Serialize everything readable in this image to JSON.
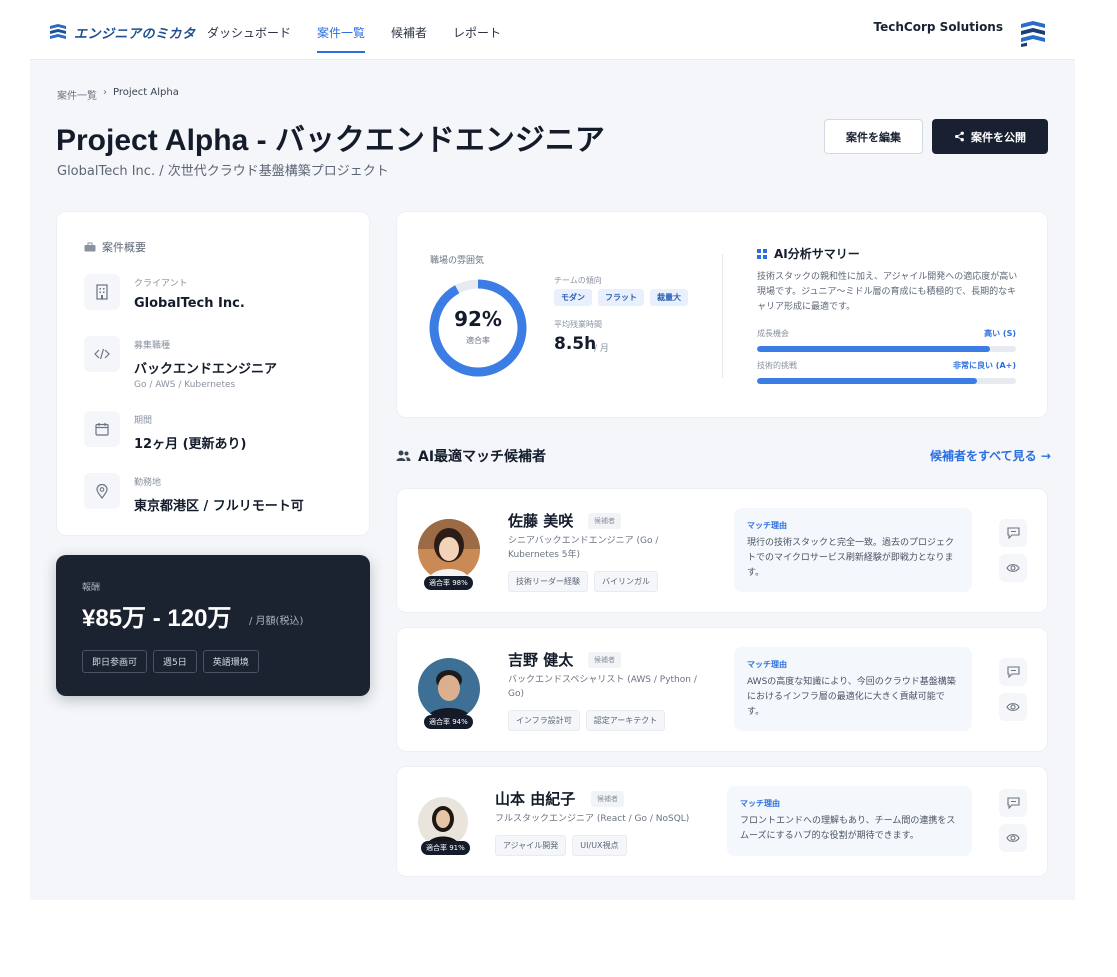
{
  "header": {
    "logo_text": "エンジニアのミカタ",
    "nav": [
      "ダッシュボード",
      "案件一覧",
      "候補者",
      "レポート"
    ],
    "active_nav": "案件一覧",
    "company": "TechCorp Solutions"
  },
  "breadcrumb": {
    "parent": "案件一覧",
    "separator": "›",
    "current": "Project Alpha"
  },
  "page": {
    "title": "Project Alpha - バックエンドエンジニア",
    "subtitle": "GlobalTech Inc. / 次世代クラウド基盤構築プロジェクト",
    "edit_button": "案件を編集",
    "publish_button": "案件を公開"
  },
  "overview": {
    "title": "案件概要",
    "client_label": "クライアント",
    "client_value": "GlobalTech Inc.",
    "role_label": "募集職種",
    "role_value": "バックエンドエンジニア",
    "role_sub": "Go / AWS / Kubernetes",
    "period_label": "期間",
    "period_value": "12ヶ月 (更新あり)",
    "location_label": "勤務地",
    "location_value": "東京都港区 / フルリモート可"
  },
  "compensation": {
    "label": "報酬",
    "amount": "¥85万 - 120万",
    "unit": "/ 月額(税込)",
    "tags": [
      "即日参画可",
      "週5日",
      "英語環境"
    ]
  },
  "atmosphere": {
    "label": "職場の雰囲気",
    "match_percent": "92%",
    "match_value": 0.92,
    "match_sub": "適合率",
    "trend_label": "チームの傾向",
    "trend_tags": [
      "モダン",
      "フラット",
      "裁量大"
    ],
    "overtime_label": "平均残業時間",
    "overtime_value": "8.5h",
    "overtime_unit": "/ 月"
  },
  "ai_summary": {
    "title": "AI分析サマリー",
    "text": "技術スタックの親和性に加え、アジャイル開発への適応度が高い現場です。ジュニア〜ミドル層の育成にも積極的で、長期的なキャリア形成に最適です。",
    "metrics": [
      {
        "label": "成長機会",
        "value": "高い (S)",
        "level": 0.9
      },
      {
        "label": "技術的挑戦",
        "value": "非常に良い (A+)",
        "level": 0.85
      }
    ]
  },
  "candidates_section": {
    "title": "AI最適マッチ候補者",
    "see_all": "候補者をすべて見る →"
  },
  "candidates": [
    {
      "name": "佐藤 美咲",
      "status": "候補者",
      "role": "シニアバックエンドエンジニア (Go / Kubernetes 5年)",
      "tags": [
        "技術リーダー経験",
        "バイリンガル"
      ],
      "match": "適合率 98%",
      "reason_title": "マッチ理由",
      "reason": "現行の技術スタックと完全一致。過去のプロジェクトでのマイクロサービス刷新経験が即戦力となります。"
    },
    {
      "name": "吉野 健太",
      "status": "候補者",
      "role": "バックエンドスペシャリスト (AWS / Python / Go)",
      "tags": [
        "インフラ設計可",
        "認定アーキテクト"
      ],
      "match": "適合率 94%",
      "reason_title": "マッチ理由",
      "reason": "AWSの高度な知識により、今回のクラウド基盤構築におけるインフラ層の最適化に大きく貢献可能です。"
    },
    {
      "name": "山本 由紀子",
      "status": "候補者",
      "role": "フルスタックエンジニア (React / Go / NoSQL)",
      "tags": [
        "アジャイル開発",
        "UI/UX視点"
      ],
      "match": "適合率 91%",
      "reason_title": "マッチ理由",
      "reason": "フロントエンドへの理解もあり、チーム間の連携をスムーズにするハブ的な役割が期待できます。"
    }
  ],
  "colors": {
    "accent": "#2c6fe0",
    "dark": "#182032",
    "background": "#f4f6f9"
  }
}
